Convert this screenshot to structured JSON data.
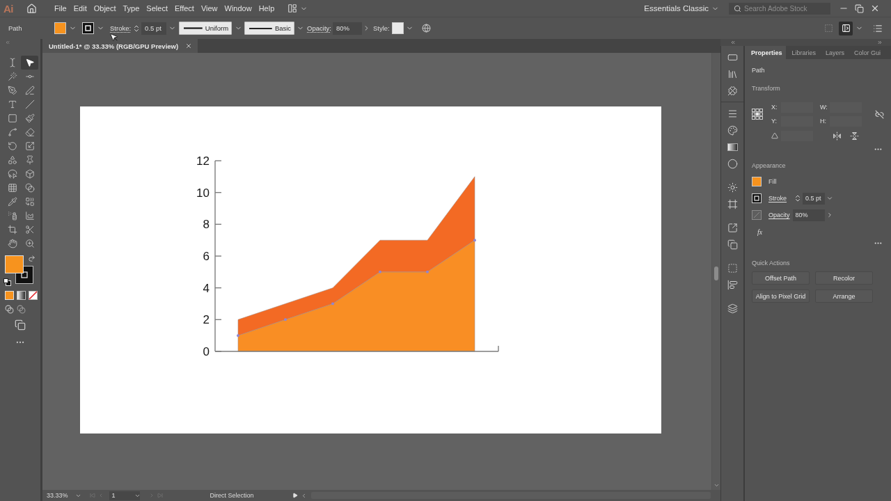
{
  "menu_bar": {
    "app_logo": "Ai",
    "menus": [
      "File",
      "Edit",
      "Object",
      "Type",
      "Select",
      "Effect",
      "View",
      "Window",
      "Help"
    ],
    "workspace": "Essentials Classic",
    "search": {
      "placeholder": "Search Adobe Stock"
    }
  },
  "control_bar": {
    "selection": "Path",
    "stroke_label": "Stroke:",
    "stroke_weight": "0.5 pt",
    "width_profile": "Uniform",
    "brush": "Basic",
    "opacity_label": "Opacity:",
    "opacity": "80%",
    "style_label": "Style:"
  },
  "toolbar": {
    "tools": [
      {
        "selected": false
      },
      {
        "selected": true
      },
      {
        "selected": false
      },
      {
        "selected": false
      },
      {
        "selected": false
      },
      {
        "selected": false
      },
      {
        "selected": false
      },
      {
        "selected": false
      },
      {
        "selected": false
      },
      {
        "selected": false
      },
      {
        "selected": false
      },
      {
        "selected": false
      },
      {
        "selected": false
      },
      {
        "selected": false
      },
      {
        "selected": false
      },
      {
        "selected": false
      },
      {
        "selected": false
      },
      {
        "selected": false
      },
      {
        "selected": false
      },
      {
        "selected": false
      },
      {
        "selected": false
      },
      {
        "selected": false
      },
      {
        "selected": false
      },
      {
        "selected": false
      },
      {
        "selected": false
      },
      {
        "selected": false
      },
      {
        "selected": false
      },
      {
        "selected": false
      }
    ]
  },
  "document_tab": {
    "title": "Untitled-1* @ 33.33% (RGB/GPU Preview)"
  },
  "artboard": {
    "chart_data": {
      "type": "area",
      "stacked": true,
      "ylim": [
        0,
        12
      ],
      "yticks": [
        0,
        2,
        4,
        6,
        8,
        10,
        12
      ],
      "series": [
        {
          "color": "#f98e24",
          "values": [
            1,
            2,
            3,
            5,
            5,
            7
          ]
        },
        {
          "color": "#f36a24",
          "values": [
            1,
            1,
            1,
            2,
            2,
            4
          ]
        }
      ]
    }
  },
  "properties_panel": {
    "tabs": [
      {
        "label": "Properties",
        "selected": true
      },
      {
        "label": "Libraries",
        "selected": false
      },
      {
        "label": "Layers",
        "selected": false
      },
      {
        "label": "Color Gui",
        "selected": false
      }
    ],
    "selection": "Path",
    "transform": {
      "title": "Transform",
      "fields": [
        {
          "label": "X:"
        },
        {
          "label": "W:"
        },
        {
          "label": "Y:"
        },
        {
          "label": "H:"
        }
      ]
    },
    "appearance": {
      "title": "Appearance",
      "fill_label": "Fill",
      "stroke_label": "Stroke",
      "stroke_weight": "0.5 pt",
      "opacity_label": "Opacity",
      "opacity": "80%",
      "effects": "fx"
    },
    "quick_actions": {
      "title": "Quick Actions",
      "buttons": [
        "Offset Path",
        "Recolor",
        "Align to Pixel Grid",
        "Arrange"
      ]
    }
  },
  "status_bar": {
    "zoom": "33.33%",
    "artboard": "1",
    "current_tool": "Direct Selection"
  }
}
